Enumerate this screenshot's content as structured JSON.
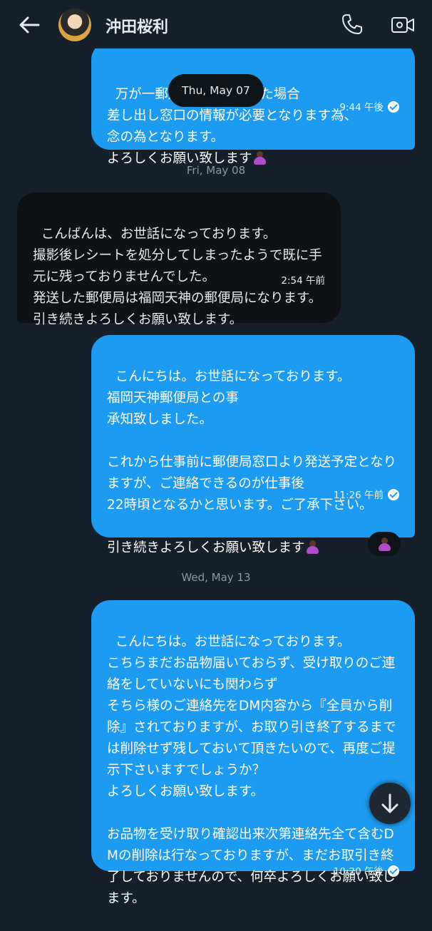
{
  "header": {
    "contact_name": "沖田桜利",
    "icons": [
      "back-arrow-icon",
      "avatar",
      "phone-icon",
      "video-call-icon"
    ]
  },
  "floating_date": "Thu, May 07",
  "messages": [
    {
      "direction": "outgoing",
      "text": "万が一郵送事故等があった場合\n差し出し窓口の情報が必要となります為、\n念の為となります。\nよろしくお願い致します",
      "time": "9:44 午後",
      "read": true
    },
    {
      "type": "date",
      "label": "Fri, May 08"
    },
    {
      "direction": "incoming",
      "text": "こんばんは、お世話になっております。\n撮影後レシートを処分してしまったようで既に手元に残っておりませんでした。\n発送した郵便局は福岡天神の郵便局になります。\n引き続きよろしくお願い致します。",
      "time": "2:54 午前"
    },
    {
      "direction": "outgoing",
      "text": "こんにちは。お世話になっております。\n福岡天神郵便局との事\n承知致しました。\n\nこれから仕事前に郵便局窓口より発送予定となりますが、ご連絡できるのが仕事後\n22時頃となるかと思います。ご了承下さい。\n\n引き続きよろしくお願い致します",
      "time": "11:26 午前",
      "read": true,
      "reaction": "person-bowing-emoji"
    },
    {
      "type": "date",
      "label": "Wed, May 13"
    },
    {
      "direction": "outgoing",
      "text": "こんにちは。お世話になっております。\nこちらまだお品物届いておらず、受け取りのご連絡をしていないにも関わらず\nそちら様のご連絡先をDM内容から『全員から削除』されておりますが、お取り引き終了するまでは削除せず残しておいて頂きたいので、再度ご提示下さいますでしょうか？\nよろしくお願い致します。\n\nお品物を受け取り確認出来次第連絡先全て含むDMの削除は行なっておりますが、まだお取引き終了しておりませんので、何卒よろしくお願い致します。",
      "time": "10:20 午後",
      "read": true
    }
  ],
  "scroll_button_icon": "arrow-down-icon",
  "colors": {
    "background": "#15202b",
    "outgoing_bubble": "#1d9bf0",
    "incoming_bubble": "#0f1114",
    "date_text": "#8b98a5"
  }
}
